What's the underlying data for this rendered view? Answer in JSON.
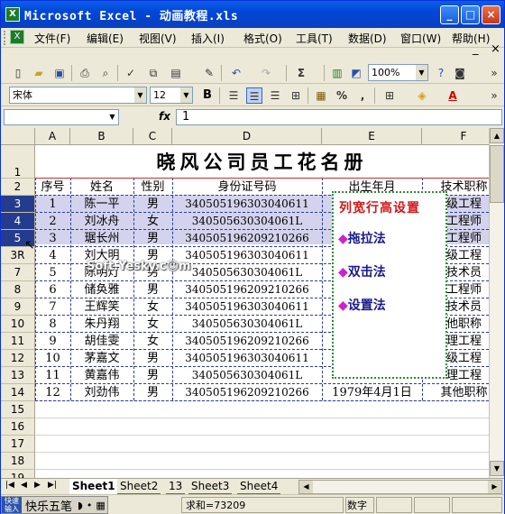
{
  "window": {
    "title": "Microsoft Excel - 动画教程.xls",
    "app_icon": "excel-icon",
    "controls": [
      "_",
      "□",
      "×"
    ]
  },
  "menu": {
    "items": [
      "文件(F)",
      "编辑(E)",
      "视图(V)",
      "插入(I)",
      "格式(O)",
      "工具(T)",
      "数据(D)",
      "窗口(W)",
      "帮助(H)"
    ],
    "doc_controls": [
      "_",
      "×"
    ]
  },
  "toolbar": {
    "zoom": "100%"
  },
  "format_toolbar": {
    "font": "宋体",
    "size": "12",
    "bold": "B",
    "currency": "%",
    "decimal": ",",
    "fill_icon": "fill-color-icon",
    "font_color_label": "A"
  },
  "formula_bar": {
    "name_box": "",
    "fx": "fx",
    "value": "1"
  },
  "sheet": {
    "columns": [
      "A",
      "B",
      "C",
      "D",
      "E",
      "F"
    ],
    "rows": [
      "1",
      "2",
      "3",
      "4",
      "5",
      "3R",
      "7",
      "8",
      "9",
      "10",
      "11",
      "12",
      "13",
      "14",
      "15",
      "16",
      "17",
      "18",
      "19"
    ],
    "title": "晓风公司员工花名册",
    "headers": [
      "序号",
      "姓名",
      "性别",
      "身份证号码",
      "出生年月",
      "技术职称"
    ],
    "data": [
      [
        "1",
        "陈一平",
        "男",
        "340505196303040611",
        "",
        "级工程"
      ],
      [
        "2",
        "刘冰舟",
        "女",
        "340505630304061L",
        "",
        "工程师"
      ],
      [
        "3",
        "琚长州",
        "男",
        "340505196209210266",
        "",
        "工程师"
      ],
      [
        "4",
        "刘大明",
        "男",
        "340505196303040611",
        "",
        "级工程"
      ],
      [
        "5",
        "陈明灯",
        "男",
        "340505630304061L",
        "",
        "技术员"
      ],
      [
        "6",
        "储奂雅",
        "男",
        "340505196209210266",
        "",
        "工程师"
      ],
      [
        "7",
        "王辉笑",
        "女",
        "340505196303040611",
        "",
        "技术员"
      ],
      [
        "8",
        "朱丹翔",
        "女",
        "340505630304061L",
        "",
        "他职称"
      ],
      [
        "9",
        "胡佳雯",
        "女",
        "340505196209210266",
        "",
        "理工程"
      ],
      [
        "10",
        "茅嘉文",
        "男",
        "340505196303040611",
        "",
        "级工程"
      ],
      [
        "11",
        "黄嘉伟",
        "男",
        "340505630304061L",
        "",
        "理工程"
      ],
      [
        "12",
        "刘劲伟",
        "男",
        "340505196209210266",
        "1979年4月1日",
        "其他职称"
      ]
    ]
  },
  "note_box": {
    "title": "列宽行高设置",
    "items": [
      "拖拉法",
      "双击法",
      "设置法"
    ],
    "bullet": "◆"
  },
  "watermark": "Soft.Yesky.c☺m",
  "tabs": [
    "Sheet1",
    "Sheet2",
    "13",
    "Sheet3",
    "Sheet4"
  ],
  "status": {
    "ime_name": "快乐五笔",
    "sum": "求和=73209",
    "mode": "数字"
  }
}
